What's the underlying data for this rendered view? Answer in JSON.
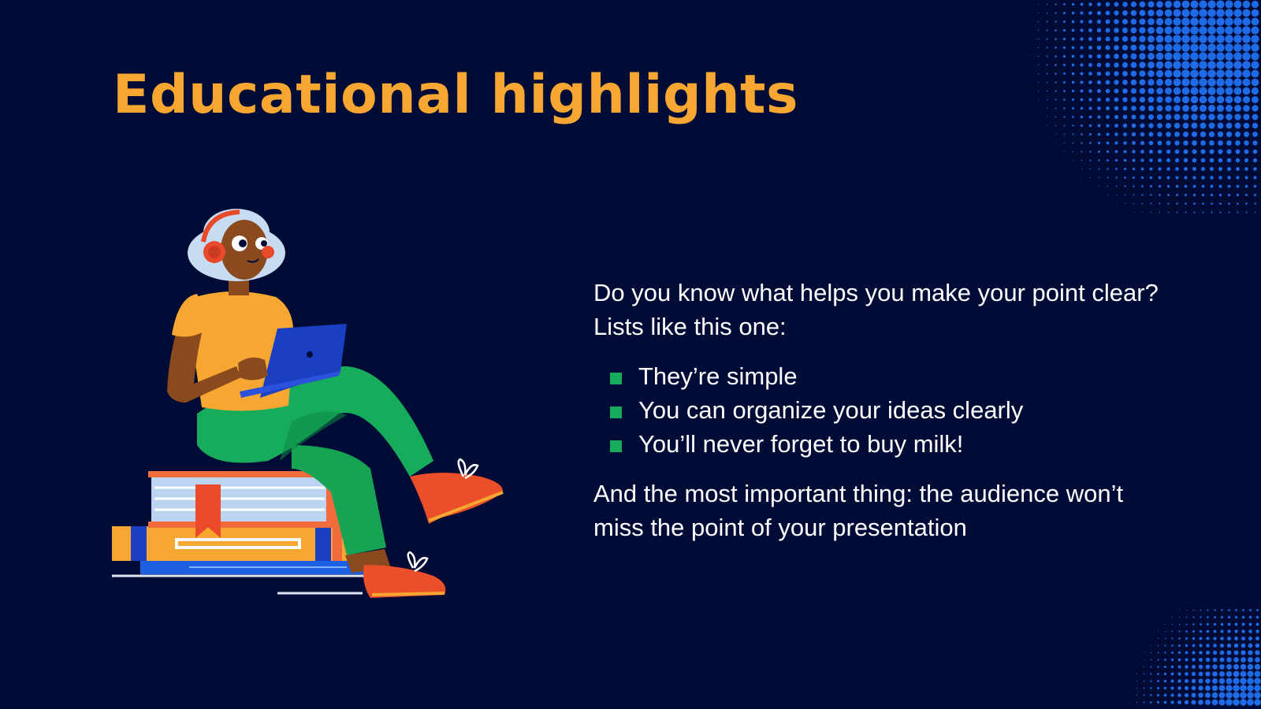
{
  "slide": {
    "title": "Educational highlights",
    "intro": "Do you know what helps you make your point clear? Lists like this one:",
    "bullets": [
      "They’re simple",
      "You can organize your ideas clearly",
      "You’ll never forget to buy milk!"
    ],
    "closing": "And the most important thing: the audience won’t miss the point of your presentation"
  },
  "colors": {
    "background": "#000c35",
    "title": "#f7a631",
    "bullet": "#17ac5c",
    "halftone": "#1f6be6",
    "text": "#ffffff"
  },
  "icons": {
    "illustration": "person-reading-on-books",
    "bullet": "green-square",
    "decoration": "blue-halftone-dots"
  }
}
